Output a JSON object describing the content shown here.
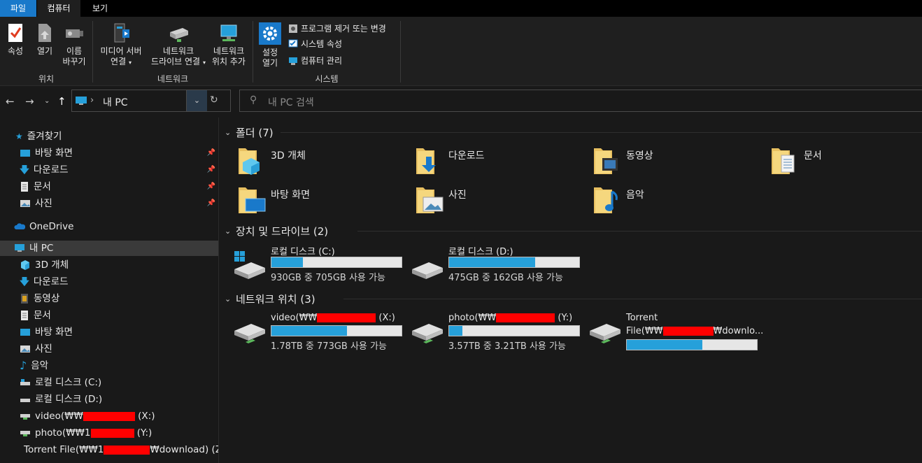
{
  "ribbon": {
    "tabs": [
      "파일",
      "컴퓨터",
      "보기"
    ],
    "location": {
      "properties": "속성",
      "open": "열기",
      "rename_1": "이름",
      "rename_2": "바꾸기",
      "label": "위치"
    },
    "network": {
      "media_1": "미디어 서버",
      "media_2": "연결",
      "map_1": "네트워크",
      "map_2": "드라이브 연결",
      "add_1": "네트워크",
      "add_2": "위치 추가",
      "label": "네트워크"
    },
    "system": {
      "settings_1": "설정",
      "settings_2": "열기",
      "uninstall": "프로그램 제거 또는 변경",
      "sys_props": "시스템 속성",
      "manage": "컴퓨터 관리",
      "label": "시스템"
    }
  },
  "address": {
    "path": "내 PC",
    "search_placeholder": "내 PC 검색"
  },
  "sidebar": {
    "quick_access": "즐겨찾기",
    "quick_items": [
      "바탕 화면",
      "다운로드",
      "문서",
      "사진"
    ],
    "onedrive": "OneDrive",
    "this_pc": "내 PC",
    "pc_items": [
      "3D 개체",
      "다운로드",
      "동영상",
      "문서",
      "바탕 화면",
      "사진",
      "음악",
      "로컬 디스크 (C:)",
      "로컬 디스크 (D:)"
    ],
    "net_video_a": "video(₩₩",
    "net_video_b": " (X:)",
    "net_photo_a": "photo(₩₩1",
    "net_photo_b": " (Y:)",
    "net_torrent_a": "Torrent File(₩₩1",
    "net_torrent_b": "₩download) (Z:"
  },
  "content": {
    "folders_title": "폴더 (7)",
    "folders": [
      "3D 개체",
      "다운로드",
      "동영상",
      "문서",
      "바탕 화면",
      "사진",
      "음악"
    ],
    "drives_title": "장치 및 드라이브 (2)",
    "drives": [
      {
        "name": "로컬 디스크 (C:)",
        "size": "930GB 중 705GB 사용 가능",
        "used_fraction": 0.24
      },
      {
        "name": "로컬 디스크 (D:)",
        "size": "475GB 중 162GB 사용 가능",
        "used_fraction": 0.66
      }
    ],
    "net_title": "네트워크 위치 (3)",
    "net": [
      {
        "name_a": "video(₩₩",
        "name_b": " (X:)",
        "size": "1.78TB 중 773GB 사용 가능",
        "used_fraction": 0.58
      },
      {
        "name_a": "photo(₩₩",
        "name_b": " (Y:)",
        "size": "3.57TB 중 3.21TB 사용 가능",
        "used_fraction": 0.1
      },
      {
        "name_1": "Torrent",
        "name_2a": "File(₩₩",
        "name_2b": "₩downlo...",
        "used_fraction": 0.58
      }
    ]
  },
  "colors": {
    "accent": "#1979ca",
    "bar_fill": "#26a0da",
    "redaction": "#ff0000"
  }
}
